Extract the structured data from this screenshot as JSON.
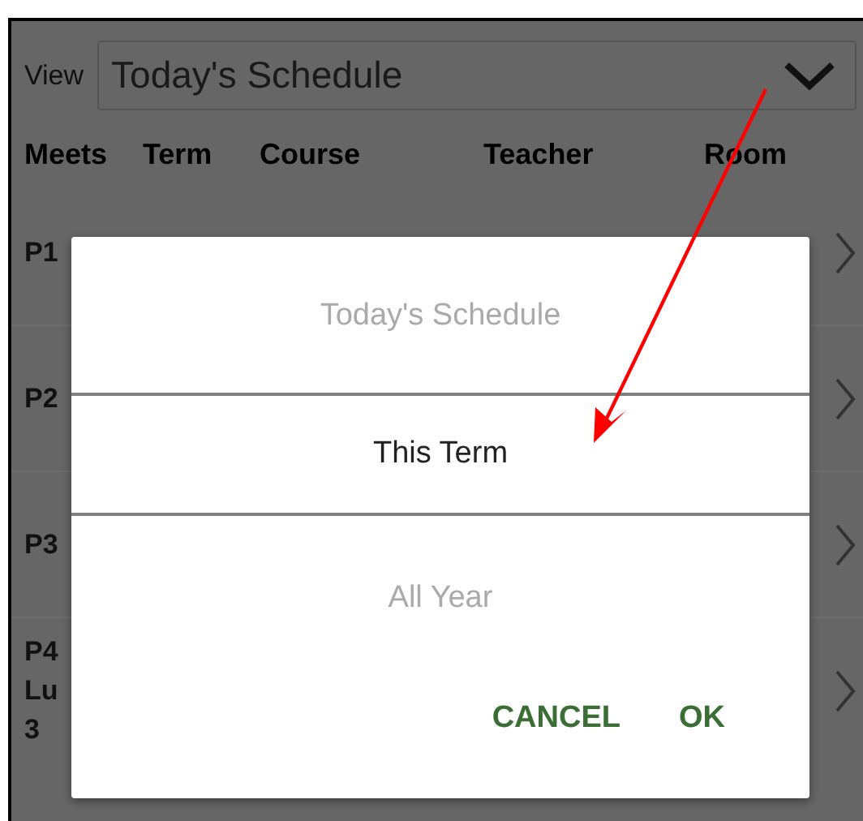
{
  "view": {
    "label": "View",
    "value": "Today's Schedule"
  },
  "columns": [
    "Meets",
    "Term",
    "Course",
    "Teacher",
    "Room"
  ],
  "rows": [
    {
      "meets": [
        "P1"
      ]
    },
    {
      "meets": [
        "P2"
      ]
    },
    {
      "meets": [
        "P3"
      ]
    },
    {
      "meets": [
        "P4",
        "Lu",
        "3"
      ]
    }
  ],
  "dialog": {
    "options": [
      {
        "label": "Today's Schedule",
        "selected": false
      },
      {
        "label": "This Term",
        "selected": true
      },
      {
        "label": "All Year",
        "selected": false
      }
    ],
    "buttons": [
      "CANCEL",
      "OK"
    ]
  }
}
